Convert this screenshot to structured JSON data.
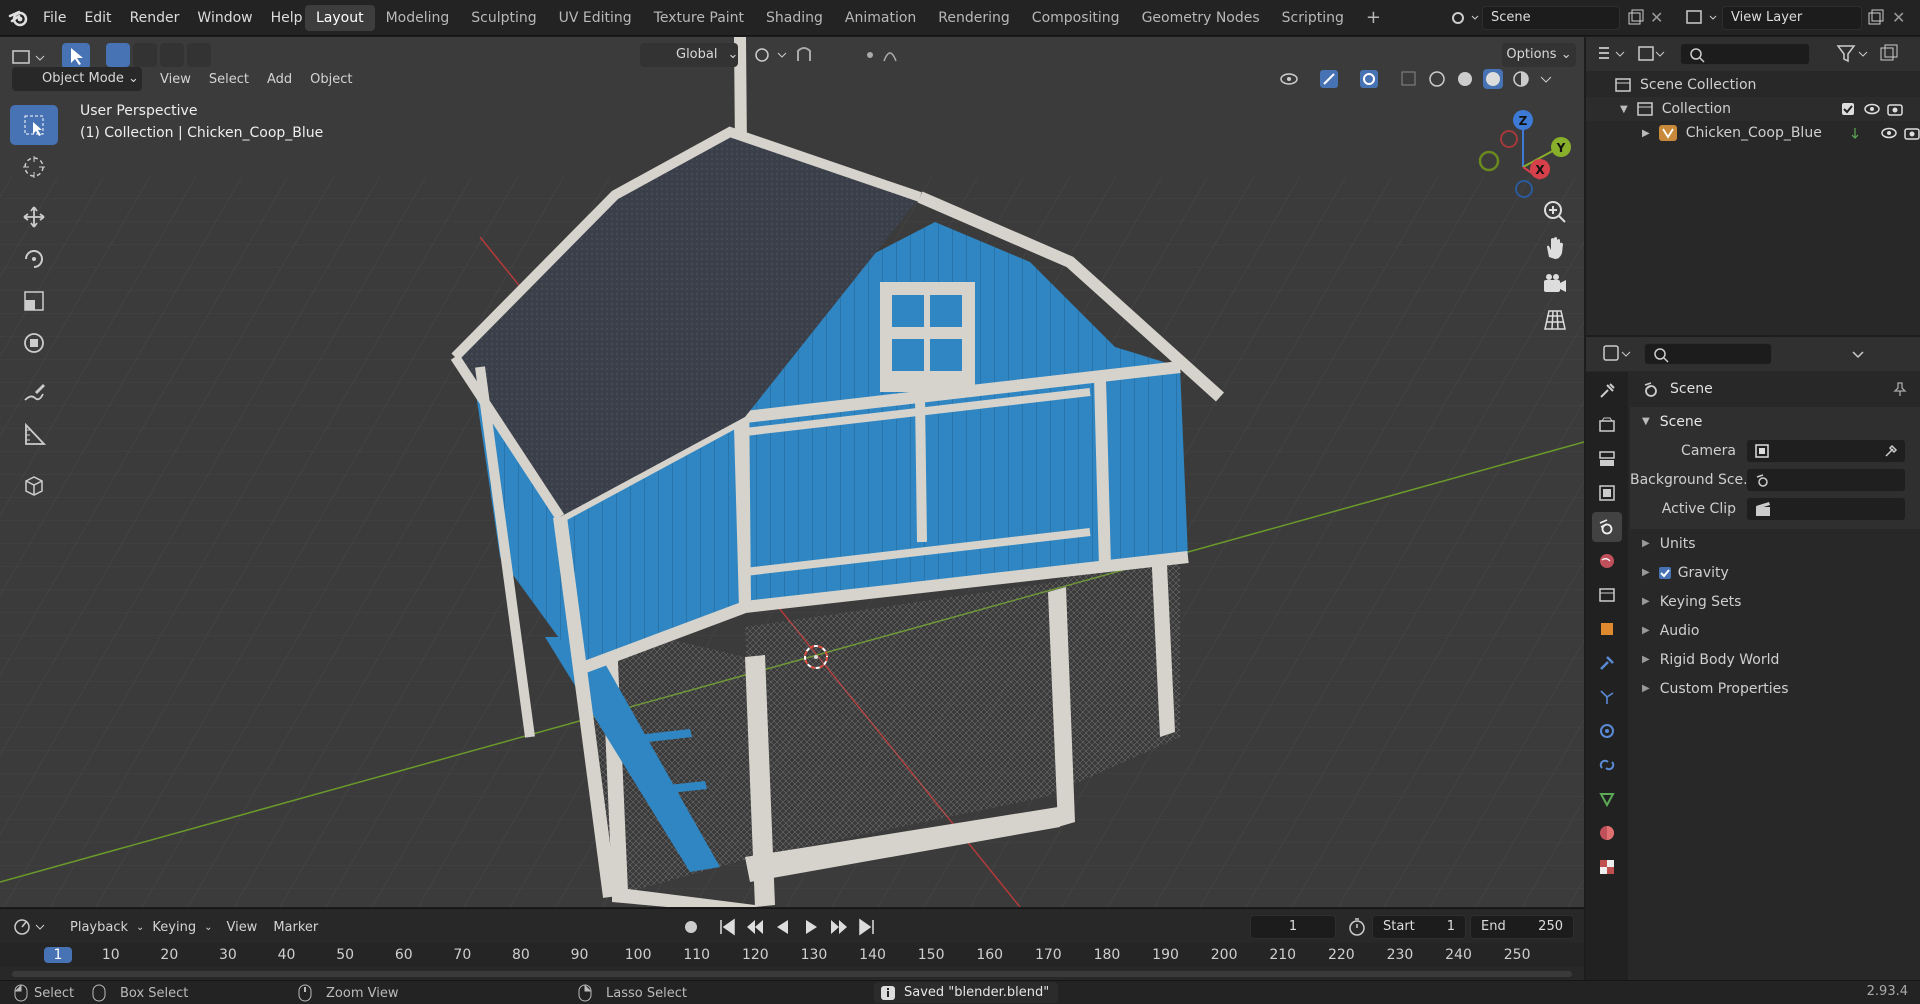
{
  "topbar": {
    "menus": [
      "File",
      "Edit",
      "Render",
      "Window",
      "Help"
    ],
    "workspaces": [
      "Layout",
      "Modeling",
      "Sculpting",
      "UV Editing",
      "Texture Paint",
      "Shading",
      "Animation",
      "Rendering",
      "Compositing",
      "Geometry Nodes",
      "Scripting"
    ],
    "active_workspace": "Layout",
    "add_workspace": "+",
    "scene_name": "Scene",
    "view_layer": "View Layer"
  },
  "viewport": {
    "mode": "Object Mode",
    "menus": [
      "View",
      "Select",
      "Add",
      "Object"
    ],
    "transform_orientation": "Global",
    "options_label": "Options",
    "overlay_line1": "User Perspective",
    "overlay_line2": "(1) Collection | Chicken_Coop_Blue",
    "gizmo_axes": {
      "x": "X",
      "y": "Y",
      "z": "Z"
    }
  },
  "outliner": {
    "root": "Scene Collection",
    "collection": "Collection",
    "object": "Chicken_Coop_Blue"
  },
  "properties": {
    "context": "Scene",
    "panel_title": "Scene",
    "fields": [
      {
        "label": "Camera",
        "value": ""
      },
      {
        "label": "Background Sce...",
        "value": ""
      },
      {
        "label": "Active Clip",
        "value": ""
      }
    ],
    "sections": [
      "Units",
      "Gravity",
      "Keying Sets",
      "Audio",
      "Rigid Body World",
      "Custom Properties"
    ],
    "gravity_checked": true
  },
  "timeline": {
    "menus": [
      "Playback",
      "Keying",
      "View",
      "Marker"
    ],
    "current_frame": "1",
    "start_label": "Start",
    "start_value": "1",
    "end_label": "End",
    "end_value": "250",
    "ticks": [
      "1",
      "10",
      "20",
      "30",
      "40",
      "50",
      "60",
      "70",
      "80",
      "90",
      "100",
      "110",
      "120",
      "130",
      "140",
      "150",
      "160",
      "170",
      "180",
      "190",
      "200",
      "210",
      "220",
      "230",
      "240",
      "250"
    ]
  },
  "statusbar": {
    "select": "Select",
    "box_select": "Box Select",
    "zoom_view": "Zoom View",
    "lasso_select": "Lasso Select",
    "saved_message": "Saved \"blender.blend\"",
    "version": "2.93.4"
  },
  "colors": {
    "accent": "#4772b3",
    "coop_blue": "#2f86c2",
    "trim": "#d6d3cc",
    "roof": "#3a3f49",
    "grid_bg": "#3b3b3b"
  }
}
